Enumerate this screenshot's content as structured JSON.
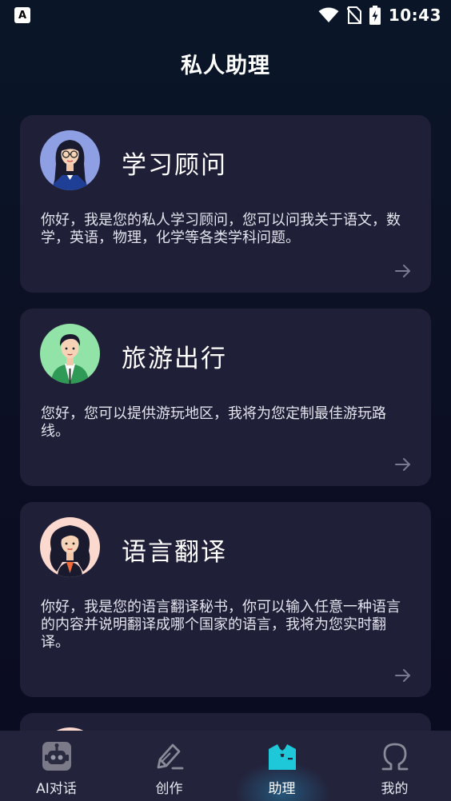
{
  "status_bar": {
    "time": "10:43"
  },
  "header": {
    "title": "私人助理"
  },
  "cards": [
    {
      "title": "学习顾问",
      "description": "你好，我是您的私人学习顾问，您可以问我关于语文，数学，英语，物理，化学等各类学科问题。"
    },
    {
      "title": "旅游出行",
      "description": "您好，您可以提供游玩地区，我将为您定制最佳游玩路线。"
    },
    {
      "title": "语言翻译",
      "description": "你好，我是您的语言翻译秘书，你可以输入任意一种语言的内容并说明翻译成哪个国家的语言，我将为您实时翻译。"
    }
  ],
  "tabs": [
    {
      "label": "AI对话",
      "icon": "robot-icon"
    },
    {
      "label": "创作",
      "icon": "pen-icon"
    },
    {
      "label": "助理",
      "icon": "suit-icon",
      "active": true
    },
    {
      "label": "我的",
      "icon": "profile-icon"
    }
  ],
  "colors": {
    "background": "#0c1024",
    "card": "#1f1f37",
    "tabbar": "#23233b",
    "accent": "#1ec8d8"
  }
}
